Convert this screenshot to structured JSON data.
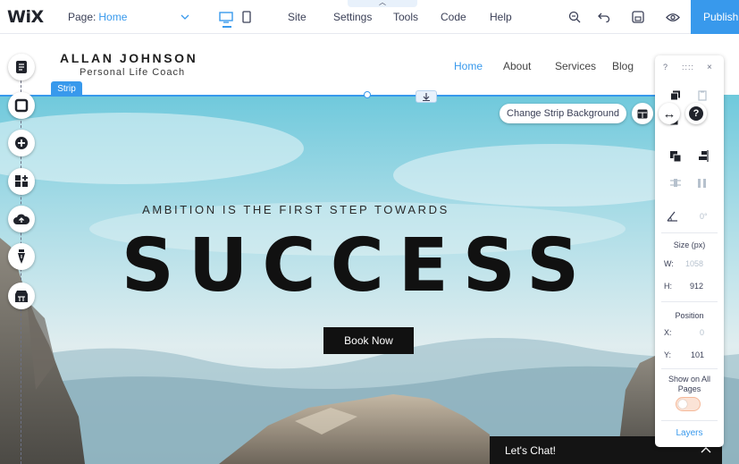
{
  "topbar": {
    "logo": "WiX",
    "page_label": "Page:",
    "page_value": "Home",
    "menu": [
      "Site",
      "Settings",
      "Tools",
      "Code",
      "Help"
    ],
    "publish": "Publish"
  },
  "header": {
    "brand_name": "ALLAN JOHNSON",
    "brand_sub": "Personal Life Coach",
    "nav": [
      "Home",
      "About",
      "Services",
      "Blog"
    ]
  },
  "strip": {
    "tag": "Strip",
    "change_bg": "Change Strip Background"
  },
  "hero": {
    "tagline": "AMBITION IS THE FIRST STEP TOWARDS",
    "headline": "SUCCESS",
    "cta": "Book Now"
  },
  "chat": {
    "label": "Let's Chat!"
  },
  "panel": {
    "help": "?",
    "drag": "::::",
    "close": "×",
    "rotation": "0°",
    "size_label": "Size (px)",
    "w_label": "W:",
    "w_value": "1058",
    "h_label": "H:",
    "h_value": "912",
    "position_label": "Position",
    "x_label": "X:",
    "x_value": "0",
    "y_label": "Y:",
    "y_value": "101",
    "show_all": "Show on All Pages",
    "layers": "Layers"
  },
  "colors": {
    "accent": "#3899ec",
    "dark": "#111111"
  }
}
